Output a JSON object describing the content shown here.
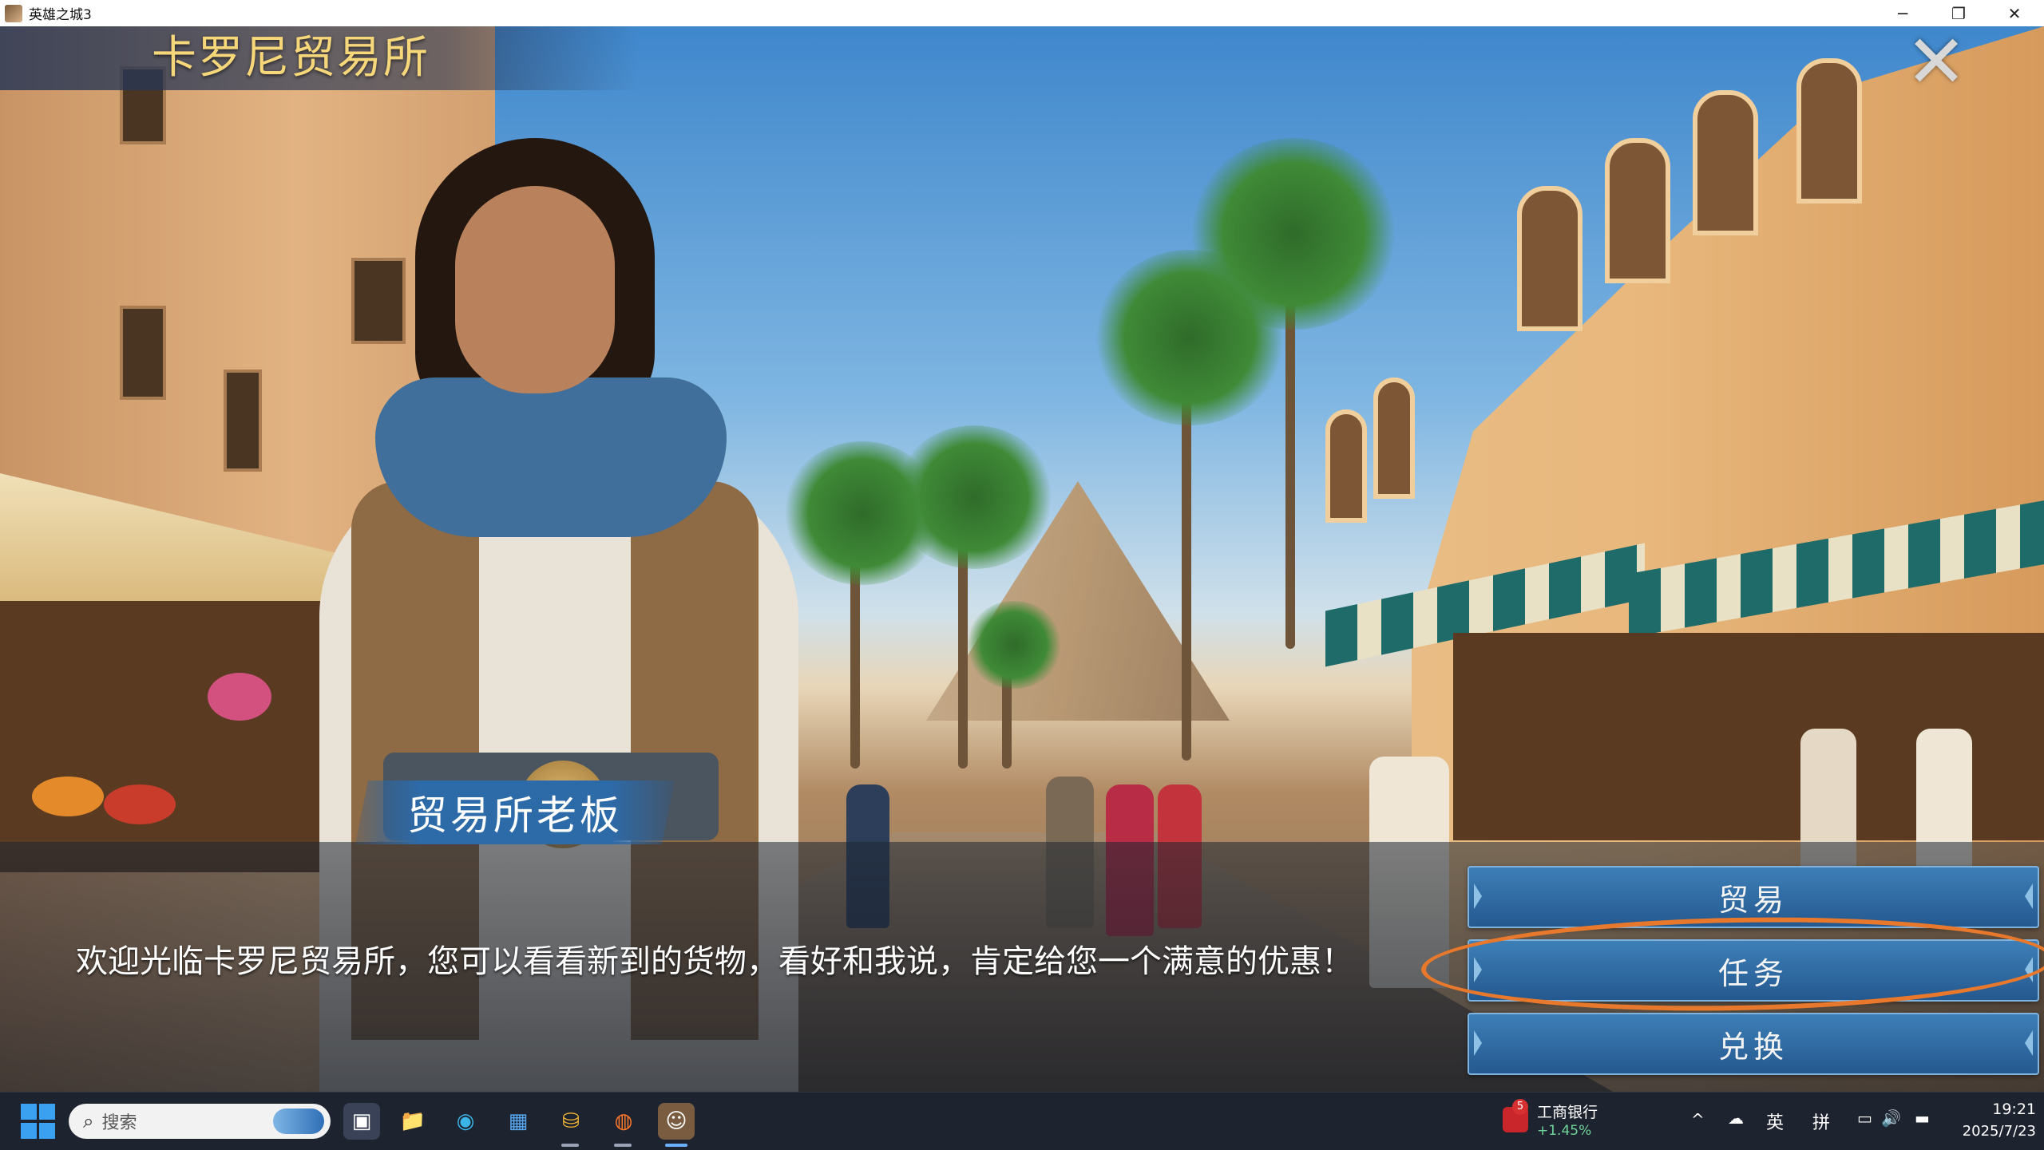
{
  "window": {
    "title": "英雄之城3",
    "minimize_glyph": "─",
    "restore_glyph": "❐",
    "close_glyph": "✕"
  },
  "game": {
    "location_title": "卡罗尼贸易所",
    "close_glyph": "✕",
    "speaker_name": "贸易所老板",
    "dialog_text": "欢迎光临卡罗尼贸易所，您可以看看新到的货物，看好和我说，肯定给您一个满意的优惠！",
    "menu": [
      {
        "label": "贸易"
      },
      {
        "label": "任务"
      },
      {
        "label": "兑换"
      }
    ],
    "annotation_color": "#e8782b"
  },
  "taskbar": {
    "search_placeholder": "搜索",
    "search_icon": "search-icon",
    "apps": [
      {
        "name": "task-view-icon",
        "glyph": "▣"
      },
      {
        "name": "file-explorer-icon",
        "glyph": "📁"
      },
      {
        "name": "edge-icon",
        "glyph": "◉"
      },
      {
        "name": "microsoft-store-icon",
        "glyph": "▦"
      },
      {
        "name": "game-app-icon",
        "glyph": "⛁"
      },
      {
        "name": "firefox-icon",
        "glyph": "◍"
      },
      {
        "name": "hero-city-app-icon",
        "glyph": "☺"
      }
    ],
    "stock": {
      "badge": "5",
      "name": "工商银行",
      "change": "+1.45%"
    },
    "tray": {
      "chevron": "^",
      "cloud_icon": "☁",
      "ime_lang": "英",
      "ime_mode": "拼",
      "network_icon": "▭",
      "volume_icon": "🔊",
      "battery_icon": "▬",
      "time": "19:21",
      "date": "2025/7/23"
    }
  }
}
